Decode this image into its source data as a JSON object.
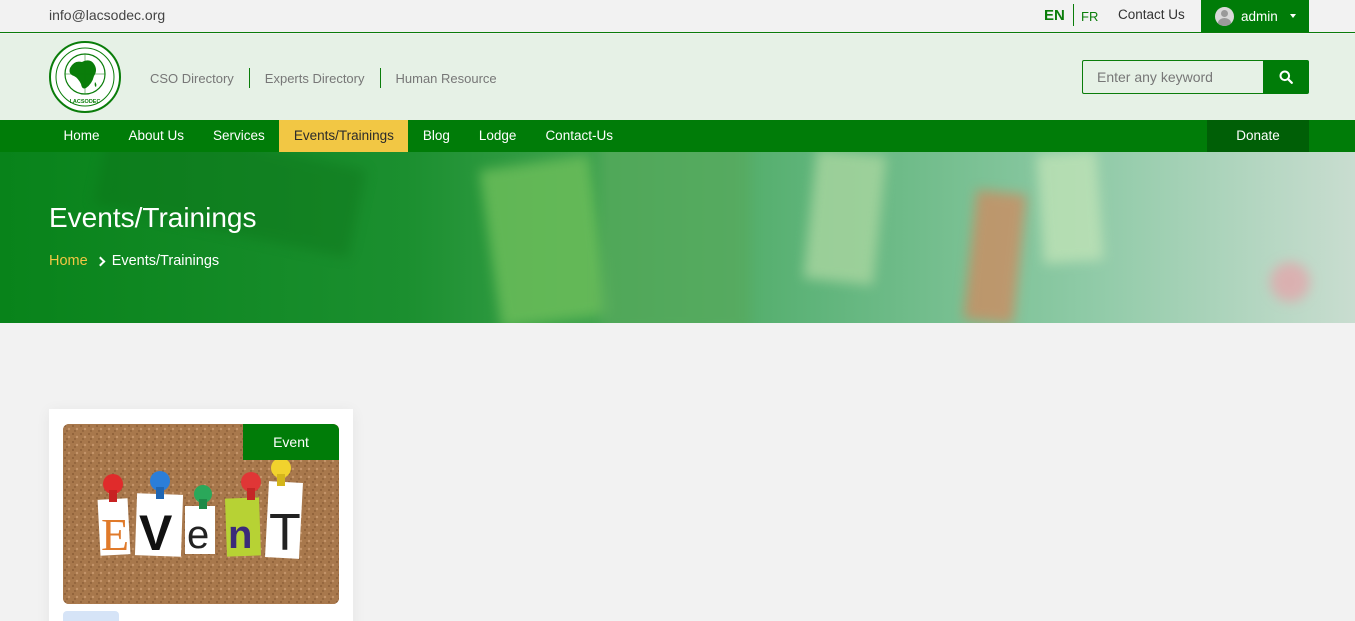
{
  "topbar": {
    "email": "info@lacsodec.org",
    "lang_en": "EN",
    "lang_fr": "FR",
    "contact": "Contact Us",
    "user": "admin"
  },
  "header": {
    "logo_text": "LACSODEC",
    "links": [
      "CSO Directory",
      "Experts Directory",
      "Human Resource"
    ],
    "search_placeholder": "Enter any keyword"
  },
  "nav": {
    "items": [
      "Home",
      "About Us",
      "Services",
      "Events/Trainings",
      "Blog",
      "Lodge",
      "Contact-Us"
    ],
    "active": "Events/Trainings",
    "donate": "Donate"
  },
  "hero": {
    "title": "Events/Trainings",
    "breadcrumb_home": "Home",
    "breadcrumb_current": "Events/Trainings"
  },
  "card": {
    "badge": "Event",
    "image_letters": [
      "E",
      "V",
      "e",
      "n",
      "T"
    ]
  },
  "colors": {
    "primary_green": "#007c08",
    "accent_yellow": "#f2c744",
    "header_bg": "#e6f1e6"
  }
}
